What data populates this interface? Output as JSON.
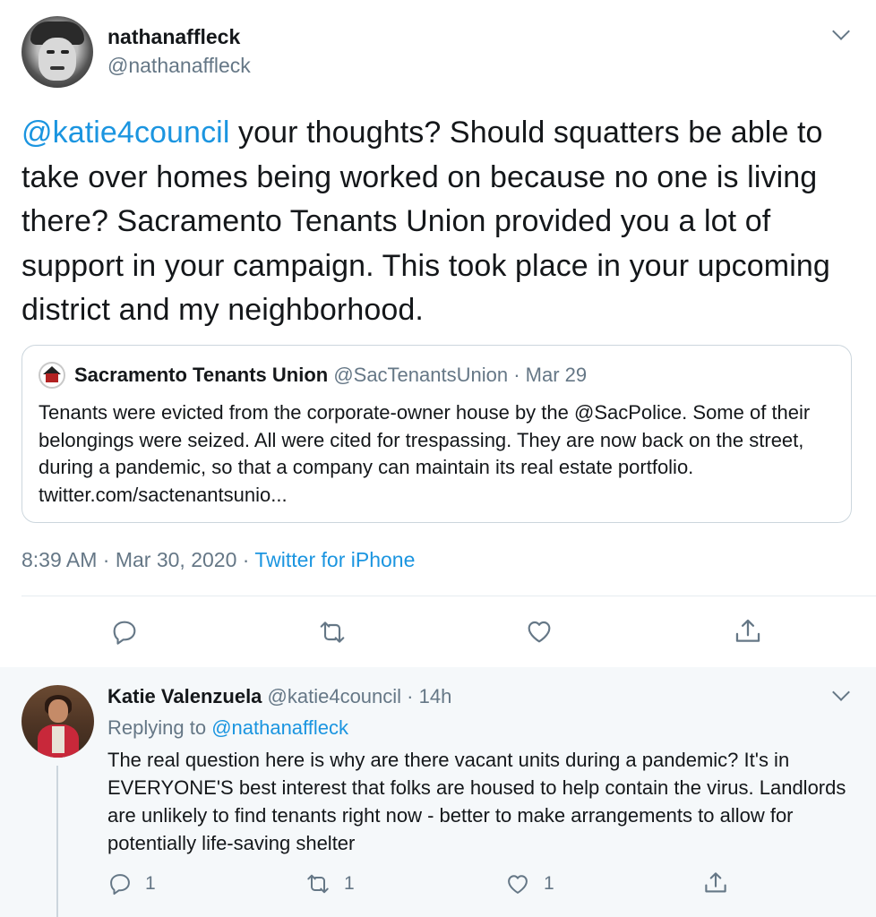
{
  "main_tweet": {
    "author_name": "nathanaffleck",
    "author_handle": "@nathanaffleck",
    "mention": "@katie4council",
    "text": " your thoughts? Should squatters be able to take over homes being worked on because no one is living there? Sacramento Tenants Union provided you a lot of support in your campaign. This took place in your upcoming district and my neighborhood.",
    "time": "8:39 AM · Mar 30, 2020 · ",
    "source": "Twitter for iPhone",
    "icons": [
      "reply-icon",
      "retweet-icon",
      "like-icon",
      "share-icon",
      "chevron-down-icon"
    ]
  },
  "quoted_tweet": {
    "author_name": "Sacramento Tenants Union",
    "author_handle": " @SacTenantsUnion",
    "date": " · Mar 29",
    "text_before": "Tenants were evicted from the corporate-owner house by the ",
    "mention": "@SacPolice",
    "text_after": ". Some of their belongings were seized. All were cited for trespassing. They are now back on the street, during a pandemic, so that a company can maintain its real estate portfolio. twitter.com/sactenantsunio..."
  },
  "reply": {
    "author_name": "Katie Valenzuela",
    "author_handle": " @katie4council",
    "age": " · 14h",
    "replying_label": "Replying to ",
    "replying_to": "@nathanaffleck",
    "text": "The real question here is why are there vacant units during a pandemic? It's in EVERYONE'S best interest that folks are housed to help contain the virus. Landlords are unlikely to find tenants right now - better to make arrangements to allow for potentially life-saving shelter",
    "reply_count": "1",
    "retweet_count": "1",
    "like_count": "1"
  },
  "colors": {
    "link": "#1b95e0",
    "muted": "#657786",
    "text": "#14171a",
    "reply_bg": "#f5f8fa",
    "border": "#ccd6dd"
  }
}
